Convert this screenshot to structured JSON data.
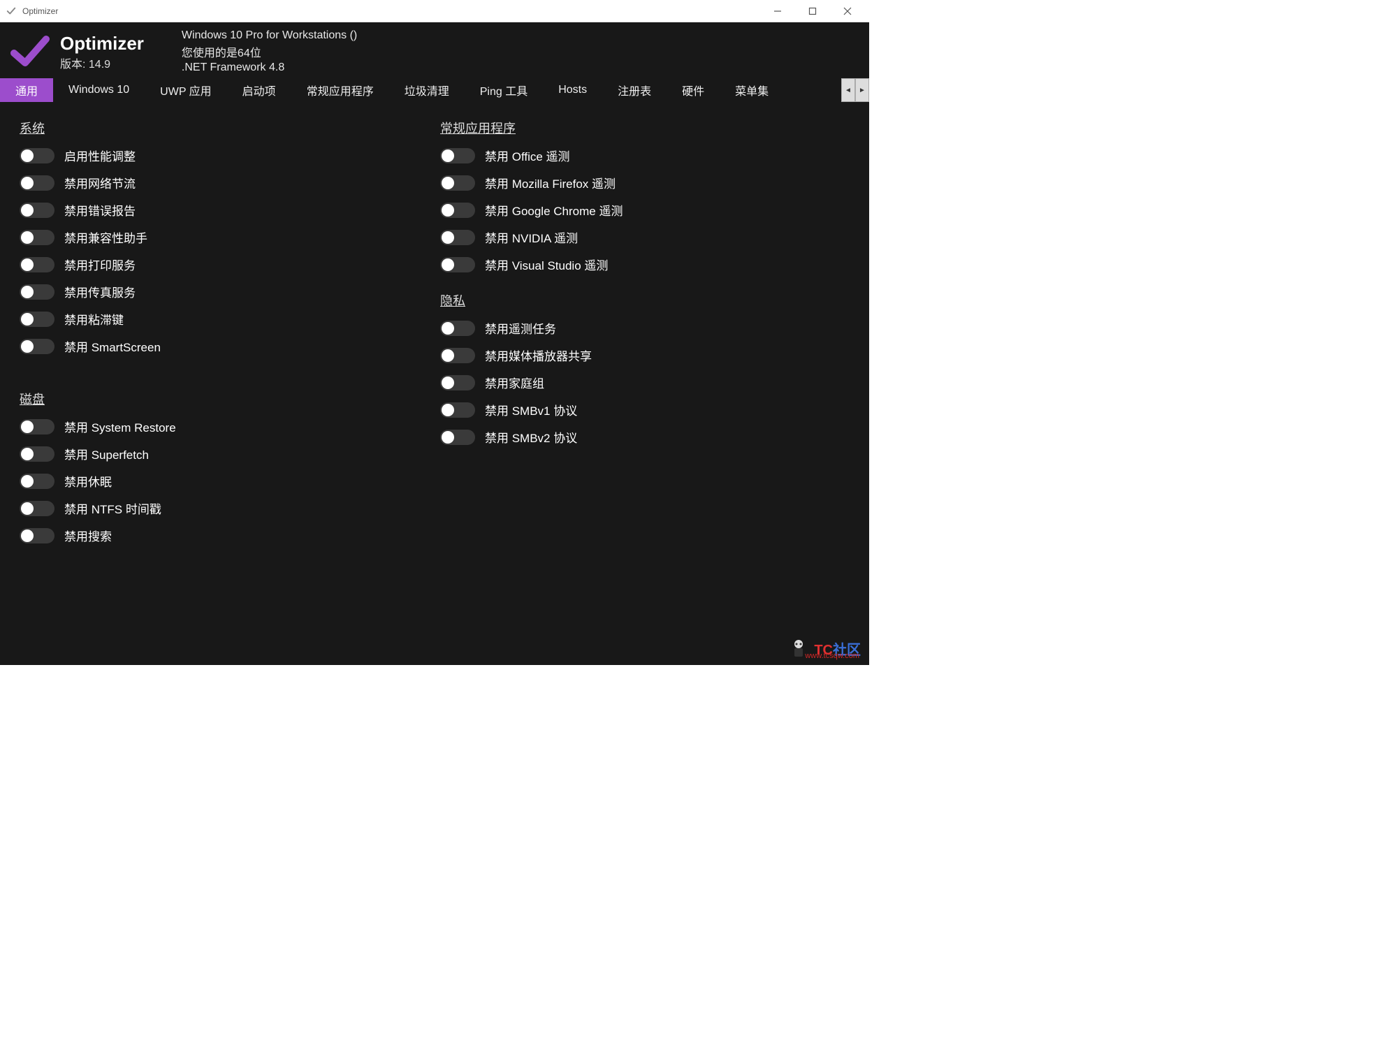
{
  "titlebar": {
    "title": "Optimizer"
  },
  "header": {
    "app_name": "Optimizer",
    "version_label": "版本:",
    "version_value": "14.9",
    "os_line": "Windows 10 Pro for Workstations ()",
    "arch_line": "您使用的是64位",
    "net_line": ".NET Framework 4.8"
  },
  "tabs": [
    {
      "label": "通用",
      "active": true
    },
    {
      "label": "Windows 10",
      "active": false
    },
    {
      "label": "UWP 应用",
      "active": false
    },
    {
      "label": "启动项",
      "active": false
    },
    {
      "label": "常规应用程序",
      "active": false
    },
    {
      "label": "垃圾清理",
      "active": false
    },
    {
      "label": "Ping 工具",
      "active": false
    },
    {
      "label": "Hosts",
      "active": false
    },
    {
      "label": "注册表",
      "active": false
    },
    {
      "label": "硬件",
      "active": false
    },
    {
      "label": "菜单集",
      "active": false
    }
  ],
  "sections": {
    "system": {
      "title": "系统",
      "items": [
        {
          "label": "启用性能调整",
          "on": false
        },
        {
          "label": "禁用网络节流",
          "on": false
        },
        {
          "label": "禁用错误报告",
          "on": false
        },
        {
          "label": "禁用兼容性助手",
          "on": false
        },
        {
          "label": "禁用打印服务",
          "on": false
        },
        {
          "label": "禁用传真服务",
          "on": false
        },
        {
          "label": "禁用粘滞键",
          "on": false
        },
        {
          "label": "禁用 SmartScreen",
          "on": false
        }
      ]
    },
    "disk": {
      "title": "磁盘",
      "items": [
        {
          "label": "禁用 System Restore",
          "on": false
        },
        {
          "label": "禁用 Superfetch",
          "on": false
        },
        {
          "label": "禁用休眠",
          "on": false
        },
        {
          "label": "禁用 NTFS 时间戳",
          "on": false
        },
        {
          "label": "禁用搜索",
          "on": false
        }
      ]
    },
    "apps": {
      "title": "常规应用程序",
      "items": [
        {
          "label": "禁用 Office 遥测",
          "on": false
        },
        {
          "label": "禁用 Mozilla Firefox 遥测",
          "on": false
        },
        {
          "label": "禁用 Google Chrome 遥测",
          "on": false
        },
        {
          "label": "禁用 NVIDIA 遥测",
          "on": false
        },
        {
          "label": "禁用 Visual Studio 遥测",
          "on": false
        }
      ]
    },
    "privacy": {
      "title": "隐私",
      "items": [
        {
          "label": "禁用遥测任务",
          "on": false
        },
        {
          "label": "禁用媒体播放器共享",
          "on": false
        },
        {
          "label": "禁用家庭组",
          "on": false
        },
        {
          "label": "禁用 SMBv1 协议",
          "on": false
        },
        {
          "label": "禁用 SMBv2 协议",
          "on": false
        }
      ]
    }
  },
  "watermark": {
    "text1": "TC",
    "text2": "社区",
    "url": "www.tcsqw.com"
  }
}
